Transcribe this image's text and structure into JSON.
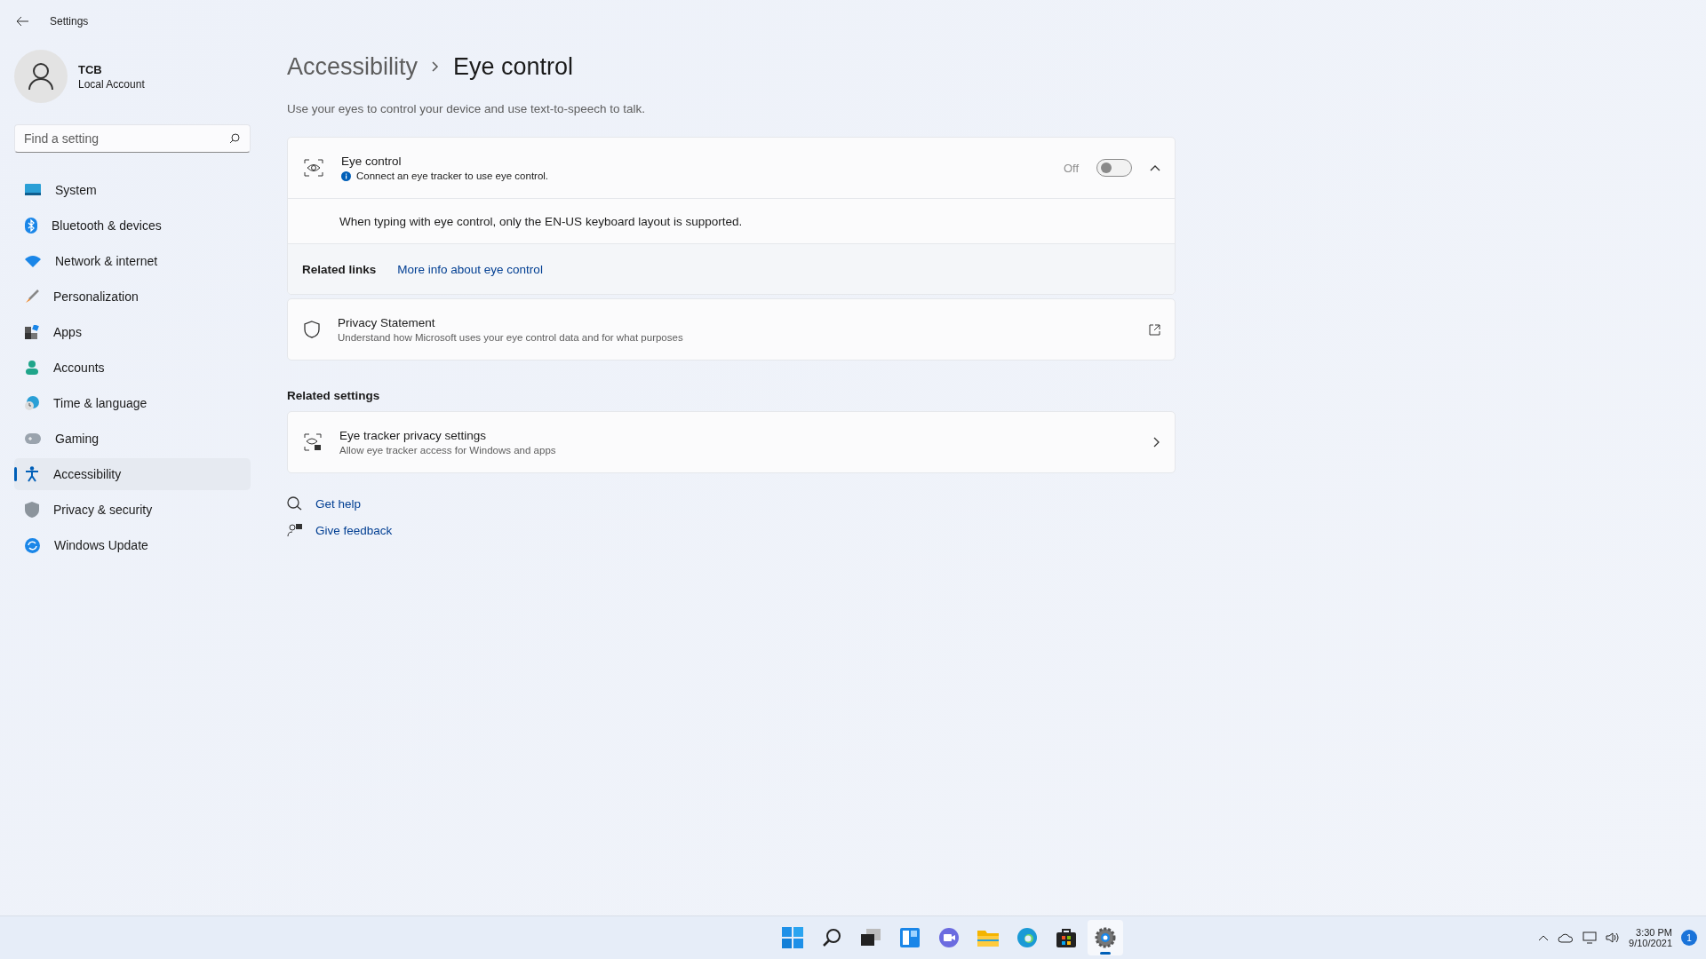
{
  "window": {
    "title": "Settings"
  },
  "account": {
    "name": "TCB",
    "type": "Local Account"
  },
  "search": {
    "placeholder": "Find a setting"
  },
  "sidebar": {
    "items": [
      {
        "label": "System",
        "selected": false
      },
      {
        "label": "Bluetooth & devices",
        "selected": false
      },
      {
        "label": "Network & internet",
        "selected": false
      },
      {
        "label": "Personalization",
        "selected": false
      },
      {
        "label": "Apps",
        "selected": false
      },
      {
        "label": "Accounts",
        "selected": false
      },
      {
        "label": "Time & language",
        "selected": false
      },
      {
        "label": "Gaming",
        "selected": false
      },
      {
        "label": "Accessibility",
        "selected": true
      },
      {
        "label": "Privacy & security",
        "selected": false
      },
      {
        "label": "Windows Update",
        "selected": false
      }
    ]
  },
  "breadcrumb": {
    "parent": "Accessibility",
    "current": "Eye control"
  },
  "description": "Use your eyes to control your device and use text-to-speech to talk.",
  "eye_control": {
    "title": "Eye control",
    "info": "Connect an eye tracker to use eye control.",
    "toggle_label": "Off",
    "on": false,
    "expanded": true,
    "note": "When typing with eye control, only the EN-US keyboard layout is supported.",
    "related_label": "Related links",
    "related_link": "More info about eye control"
  },
  "privacy": {
    "title": "Privacy Statement",
    "subtitle": "Understand how Microsoft uses your eye control data and for what purposes"
  },
  "related_settings": {
    "heading": "Related settings",
    "items": [
      {
        "title": "Eye tracker privacy settings",
        "subtitle": "Allow eye tracker access for Windows and apps"
      }
    ]
  },
  "help_links": [
    {
      "kind": "help",
      "label": "Get help"
    },
    {
      "kind": "feedback",
      "label": "Give feedback"
    }
  ],
  "taskbar": {
    "apps": [
      {
        "kind": "start",
        "selected": false
      },
      {
        "kind": "search",
        "selected": false
      },
      {
        "kind": "taskview",
        "selected": false
      },
      {
        "kind": "widgets",
        "selected": false
      },
      {
        "kind": "chat",
        "selected": false
      },
      {
        "kind": "explorer",
        "selected": false
      },
      {
        "kind": "edge",
        "selected": false
      },
      {
        "kind": "store",
        "selected": false
      },
      {
        "kind": "settings",
        "selected": true
      }
    ],
    "time": "3:30 PM",
    "date": "9/10/2021",
    "notifications": "1"
  }
}
